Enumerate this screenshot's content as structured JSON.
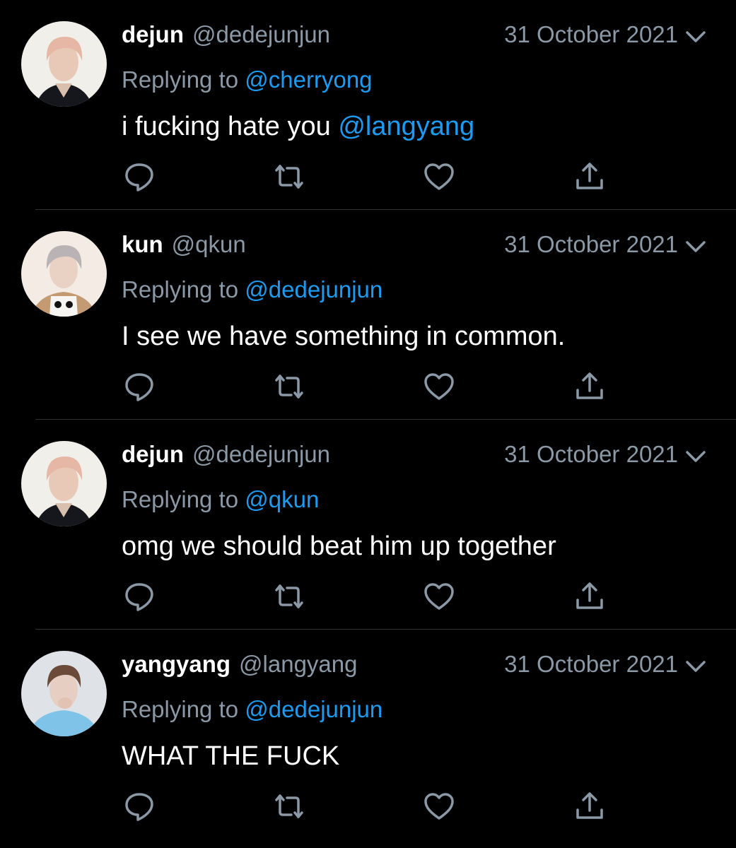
{
  "colors": {
    "background": "#000000",
    "text_primary": "#ffffff",
    "text_secondary": "#8b98a5",
    "mention": "#1d9bf0",
    "divider": "#2f3336"
  },
  "tweets": [
    {
      "name": "dejun",
      "handle": "@dedejunjun",
      "date": "31 October 2021",
      "replying_prefix": "Replying to",
      "replying_to": "@cherryong",
      "text": "i fucking hate you",
      "text_mention": "@langyang",
      "avatar_icon": "avatar-dejun"
    },
    {
      "name": "kun",
      "handle": "@qkun",
      "date": "31 October 2021",
      "replying_prefix": "Replying to",
      "replying_to": "@dedejunjun",
      "text": "I see we have something in common.",
      "text_mention": "",
      "avatar_icon": "avatar-kun"
    },
    {
      "name": "dejun",
      "handle": "@dedejunjun",
      "date": "31 October 2021",
      "replying_prefix": "Replying to",
      "replying_to": "@qkun",
      "text": "omg we should beat him up together",
      "text_mention": "",
      "avatar_icon": "avatar-dejun"
    },
    {
      "name": "yangyang",
      "handle": "@langyang",
      "date": "31 October 2021",
      "replying_prefix": "Replying to",
      "replying_to": "@dedejunjun",
      "text": "WHAT THE FUCK",
      "text_mention": "",
      "avatar_icon": "avatar-yangyang"
    }
  ],
  "action_icons": [
    "reply-icon",
    "retweet-icon",
    "like-icon",
    "share-icon"
  ]
}
